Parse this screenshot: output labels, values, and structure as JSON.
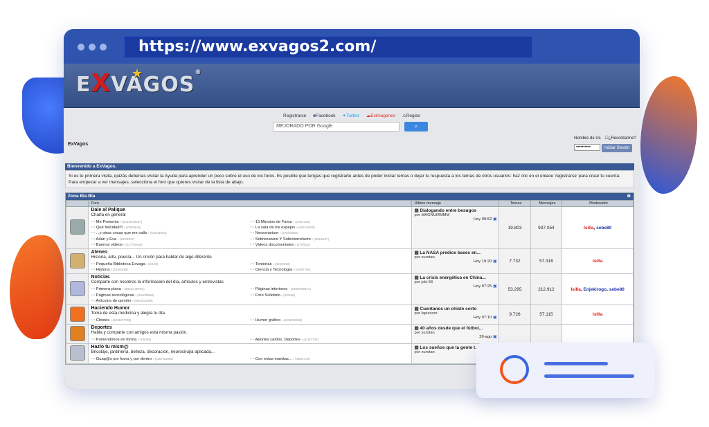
{
  "browser": {
    "url": "https://www.exvagos2.com/"
  },
  "site": {
    "logo": {
      "pre": "E",
      "x": "X",
      "post": "VAGOS",
      "reg": "®"
    },
    "links": [
      "Registrarse",
      "Facebook",
      "Twitter",
      "Eximagenes",
      "Reglas"
    ],
    "search_placeholder": "MEJORADO POR Google",
    "breadcrumb": "ExVagos",
    "login": {
      "user_label": "Nombre de Us",
      "remember_label": "¿Recordarme?",
      "password_mask": "••••••••••",
      "button": "Iniciar Sesión"
    },
    "welcome": {
      "title": "Bienvenido a ExVagos.",
      "text": "Si es tu primera visita, quizás deberías visitar la Ayuda para aprender un poco sobre el uso de los foros. Es posible que tengas que registrarte antes de poder iniciar temas o dejar tu respuesta a los temas de otros usuarios: haz clic en el enlace 'registrarse' para crear tu cuenta. Para empezar a ver mensajes, selecciona el foro que quieres visitar de la lista de abajo."
    },
    "section": {
      "title": "Zona Bla Bla",
      "cols": [
        "Foro",
        "Último mensaje",
        "Temas",
        "Mensajes",
        "Moderador"
      ]
    },
    "forums": [
      {
        "title": "Dale al Palique",
        "desc": "Charla en general",
        "subs": [
          [
            "Me Presento",
            "(10535/49267)"
          ],
          [
            "15 Minutos de Fama",
            "(150/1381)"
          ],
          [
            "Qué felicidad!!!",
            "(795/5642)"
          ],
          [
            "La sala de los espejos",
            "(583/14900)"
          ],
          [
            "...y otras cosas que me callo",
            "(615/11903)"
          ],
          [
            "Neuronarium",
            "(276/56565)"
          ],
          [
            "Adán y Eva",
            "(283/6837)"
          ],
          [
            "Sobrenatural Y Sobreterrefacto",
            "(559/8287)"
          ],
          [
            "Buenos videos",
            "(2277/9436)"
          ],
          [
            "Videos documentales",
            "(278/522)"
          ]
        ],
        "last_title": "Dialogando entre besugos",
        "last_by": "por MAGNUMMMM",
        "last_time": "Hoy 09:52",
        "temas": "19.803",
        "mensajes": "937.054",
        "mods": [
          {
            "n": "Isilla",
            "c": "r"
          },
          {
            "n": "sebe80",
            "c": "b"
          }
        ]
      },
      {
        "title": "Ateneo",
        "desc": "Historia, arte, poesía... Un rincón para hablar de algo diferente",
        "subs": [
          [
            "Pequeña Biblioteca Exvaga",
            "(5/138)"
          ],
          [
            "Tonterías",
            "(310/2819)"
          ],
          [
            "Historia",
            "(319/4939)"
          ],
          [
            "Ciencia y Tecnología",
            "(449/2755)"
          ]
        ],
        "last_title": "La NASA predice bases en...",
        "last_by": "por xurotan",
        "last_time": "Hoy 10:20",
        "temas": "7.732",
        "mensajes": "57.316",
        "mods": [
          {
            "n": "Isilla",
            "c": "r"
          }
        ]
      },
      {
        "title": "Noticias",
        "desc": "Comparte con nosotros la información del día, artículos y entrevistas",
        "subs": [
          [
            "Primera plana",
            "(2861/138787)"
          ],
          [
            "Páginas interiores",
            "(38800/86817)"
          ],
          [
            "Páginas tecnológicas",
            "(3040/8968)"
          ],
          [
            "Foro Solidario",
            "(33/358)"
          ],
          [
            "Artículos de opinión",
            "(5001/12868)"
          ]
        ],
        "last_title": "La crisis energética en China...",
        "last_by": "por joki-56",
        "last_time": "Hoy 07:25",
        "temas": "53.295",
        "mensajes": "212.912",
        "mods": [
          {
            "n": "Isilla",
            "c": "r"
          },
          {
            "n": "Enjekirogo",
            "c": "b"
          },
          {
            "n": "sebe80",
            "c": "b"
          }
        ]
      },
      {
        "title": "Haciendo Humor",
        "desc": "Toma de esta medicina y alegra tu día",
        "subs": [
          [
            "Chistes",
            "(5225/37798)"
          ],
          [
            "Humor gráfico",
            "(4499/20358)"
          ]
        ],
        "last_title": "Cuentanos un chiste corto",
        "last_by": "por lapizcero",
        "last_time": "Hoy 07:10",
        "temas": "9.726",
        "mensajes": "57.115",
        "mods": [
          {
            "n": "Isilla",
            "c": "r"
          }
        ]
      },
      {
        "title": "Deportes",
        "desc": "Habla y comparte con amigos esta misma pasión.",
        "subs": [
          [
            "Poniendonos en forma",
            "(79/595)"
          ],
          [
            "Aportes caídos, Deportes",
            "(515/7744)"
          ]
        ],
        "last_title": "40 años desde que el fútbol...",
        "last_by": "por xurotan",
        "last_time": "20-ago",
        "temas": "",
        "mensajes": "",
        "mods": []
      },
      {
        "title": "Hazlo tu mism@",
        "desc": "Bricolaje, jardinería, belleza, decoración, neurocirujía aplicada...",
        "subs": [
          [
            "Guap@s por fuera y por dentro",
            "(1887/12966)"
          ],
          [
            "Con estas manitas...",
            "(489/1476)"
          ]
        ],
        "last_title": "Los sueños que la gente t...",
        "last_by": "por xurotan",
        "last_time": "",
        "temas": "",
        "mensajes": "",
        "mods": []
      }
    ]
  },
  "colors": {
    "browser": "#2f54b0",
    "header": "#395a95",
    "mod_red": "#e01818",
    "mod_blue": "#1a2fb0"
  }
}
